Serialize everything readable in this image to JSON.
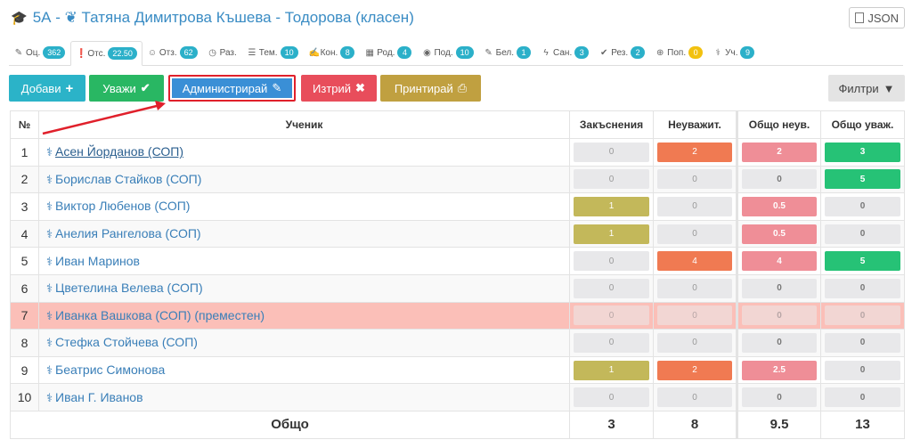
{
  "header": {
    "title": "5А - ❦ Татяна Димитрова Къшева - Тодорова (класен)",
    "json_label": "JSON"
  },
  "tabs": [
    {
      "icon": "pencil-icon",
      "label": "Оц.",
      "count": "362"
    },
    {
      "icon": "exclamation-circle-icon",
      "label": "Отс.",
      "count": "22.50",
      "active": true
    },
    {
      "icon": "feedback-icon",
      "label": "Отз.",
      "count": "62"
    },
    {
      "icon": "clock-icon",
      "label": "Раз.",
      "count": ""
    },
    {
      "icon": "list-icon",
      "label": "Тем.",
      "count": "10"
    },
    {
      "icon": "edit-icon",
      "label": "Кон.",
      "count": "8"
    },
    {
      "icon": "calendar-icon",
      "label": "Род.",
      "count": "4"
    },
    {
      "icon": "eye-icon",
      "label": "Под.",
      "count": "10"
    },
    {
      "icon": "note-icon",
      "label": "Бел.",
      "count": "1"
    },
    {
      "icon": "bolt-icon",
      "label": "Сан.",
      "count": "3"
    },
    {
      "icon": "check-circle-icon",
      "label": "Рез.",
      "count": "2"
    },
    {
      "icon": "lifebuoy-icon",
      "label": "Поп.",
      "count": "0"
    },
    {
      "icon": "person-icon",
      "label": "Уч.",
      "count": "9"
    }
  ],
  "toolbar": {
    "add": "Добави",
    "excuse": "Уважи",
    "admin": "Администрирай",
    "delete": "Изтрий",
    "print": "Принтирай",
    "filter": "Филтри"
  },
  "table": {
    "headers": [
      "№",
      "Ученик",
      "Закъснения",
      "Неуважит.",
      "Общо неув.",
      "Общо уваж."
    ],
    "rows": [
      {
        "n": "1",
        "name": "Асен Йорданов (СОП)",
        "late": "0",
        "unexc": "2",
        "tot_unexc": "2",
        "tot_exc": "3"
      },
      {
        "n": "2",
        "name": "Борислав Стайков (СОП)",
        "late": "0",
        "unexc": "0",
        "tot_unexc": "0",
        "tot_exc": "5"
      },
      {
        "n": "3",
        "name": "Виктор Любенов (СОП)",
        "late": "1",
        "unexc": "0",
        "tot_unexc": "0.5",
        "tot_exc": "0"
      },
      {
        "n": "4",
        "name": "Анелия Рангелова (СОП)",
        "late": "1",
        "unexc": "0",
        "tot_unexc": "0.5",
        "tot_exc": "0"
      },
      {
        "n": "5",
        "name": "Иван Маринов",
        "late": "0",
        "unexc": "4",
        "tot_unexc": "4",
        "tot_exc": "5"
      },
      {
        "n": "6",
        "name": "Цветелина Велева (СОП)",
        "late": "0",
        "unexc": "0",
        "tot_unexc": "0",
        "tot_exc": "0"
      },
      {
        "n": "7",
        "name": "Иванка Вашкова (СОП) (преместен)",
        "late": "0",
        "unexc": "0",
        "tot_unexc": "0",
        "tot_exc": "0"
      },
      {
        "n": "8",
        "name": "Стефка Стойчева (СОП)",
        "late": "0",
        "unexc": "0",
        "tot_unexc": "0",
        "tot_exc": "0"
      },
      {
        "n": "9",
        "name": "Беатрис Симонова",
        "late": "1",
        "unexc": "2",
        "tot_unexc": "2.5",
        "tot_exc": "0"
      },
      {
        "n": "10",
        "name": "Иван Г. Иванов",
        "late": "0",
        "unexc": "0",
        "tot_unexc": "0",
        "tot_exc": "0"
      }
    ],
    "footer": {
      "label": "Общо",
      "late": "3",
      "unexc": "8",
      "tot_unexc": "9.5",
      "tot_exc": "13"
    }
  },
  "colors": {
    "late": "#c3b85a",
    "unexcused": "#f07a52",
    "total_unexcused": "#ef8e97",
    "total_excused": "#26c276",
    "moved_row": "#fbbfb8",
    "highlight_border": "#e0202b"
  }
}
